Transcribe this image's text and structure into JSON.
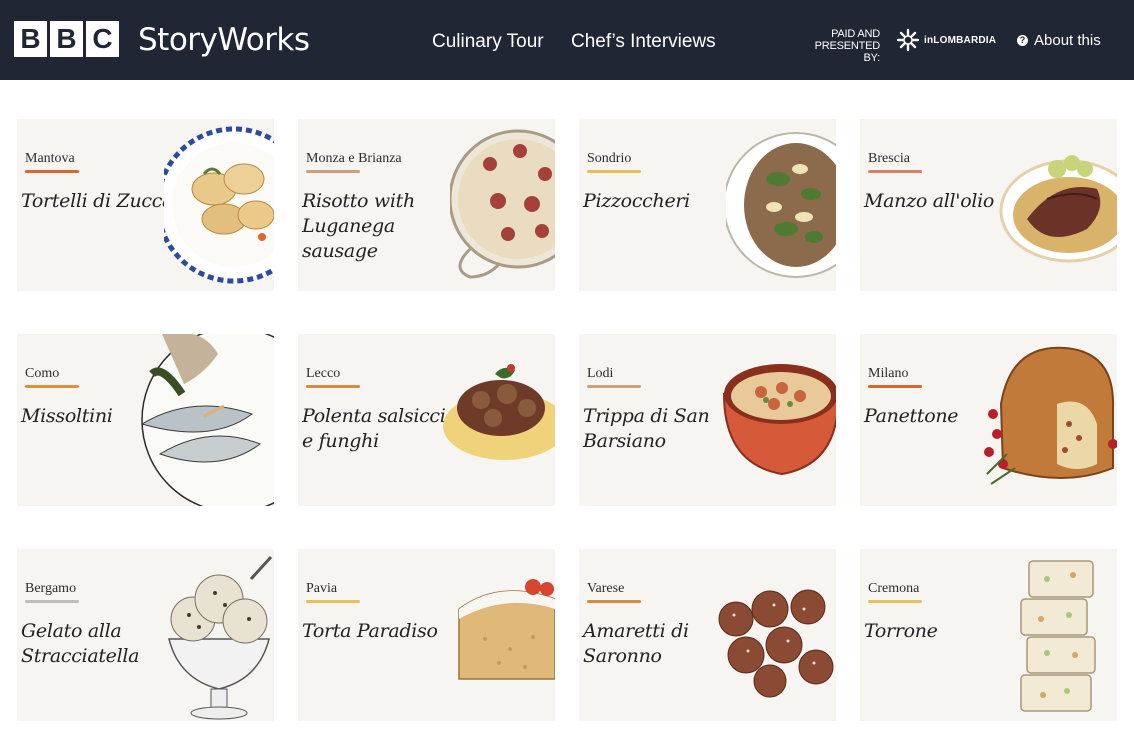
{
  "header": {
    "bbc_letters": [
      "B",
      "B",
      "C"
    ],
    "brand": "StoryWorks",
    "nav": [
      "Culinary Tour",
      "Chef’s Interviews"
    ],
    "sponsor_line1": "PAID AND",
    "sponsor_line2": "PRESENTED BY:",
    "sponsor_brand": "inLOMBARDIA",
    "about": "About this",
    "about_icon": "?",
    "colors": {
      "bar": "#202634",
      "text": "#ffffff"
    }
  },
  "cards": [
    {
      "city": "Mantova",
      "dish": "Tortelli di Zucca",
      "accent": "#d9662b",
      "image": "tortelli-plate"
    },
    {
      "city": "Monza e Brianza",
      "dish": "Risotto with Luganega sausage",
      "accent": "#c9a27a",
      "image": "risotto-pan"
    },
    {
      "city": "Sondrio",
      "dish": "Pizzoccheri",
      "accent": "#e6c15a",
      "image": "pizzoccheri-bowl"
    },
    {
      "city": "Brescia",
      "dish": "Manzo all'olio",
      "accent": "#d9826b",
      "image": "beef-plate"
    },
    {
      "city": "Como",
      "dish": "Missoltini",
      "accent": "#e0903a",
      "image": "fish-plate"
    },
    {
      "city": "Lecco",
      "dish": "Polenta salsiccia e funghi",
      "accent": "#d98a3a",
      "image": "polenta-dish"
    },
    {
      "city": "Lodi",
      "dish": "Trippa di San Barsiano",
      "accent": "#c9a27a",
      "image": "tripe-pot"
    },
    {
      "city": "Milano",
      "dish": "Panettone",
      "accent": "#d9662b",
      "image": "panettone"
    },
    {
      "city": "Bergamo",
      "dish": "Gelato alla Stracciatella",
      "accent": "#bdbdbd",
      "image": "gelato-cup"
    },
    {
      "city": "Pavia",
      "dish": "Torta Paradiso",
      "accent": "#e6c15a",
      "image": "cake-slice"
    },
    {
      "city": "Varese",
      "dish": "Amaretti di Saronno",
      "accent": "#d98a3a",
      "image": "amaretti"
    },
    {
      "city": "Cremona",
      "dish": "Torrone",
      "accent": "#e6c15a",
      "image": "torrone-stack"
    }
  ]
}
